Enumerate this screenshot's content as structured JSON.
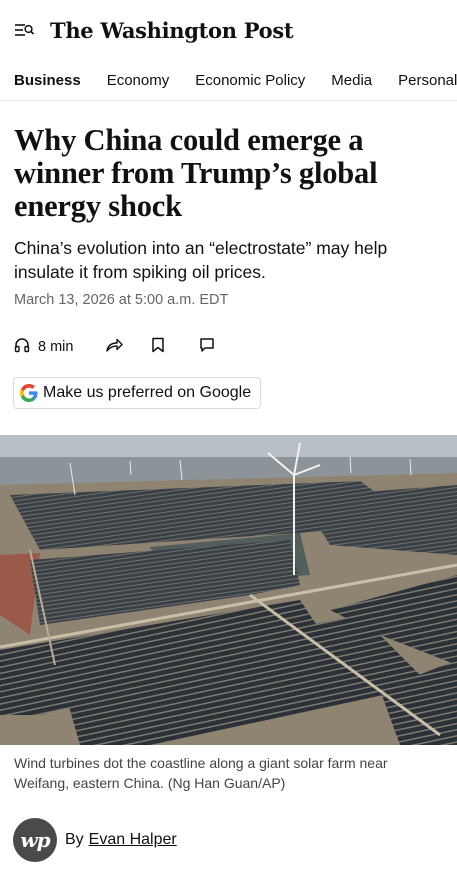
{
  "header": {
    "logo_text": "The Washington Post",
    "menu_icon": "menu-icon"
  },
  "nav": {
    "sections": [
      "Business",
      "Economy",
      "Economic Policy",
      "Media",
      "Personal Fina"
    ],
    "active": "Business"
  },
  "article": {
    "headline": "Why China could emerge a winner from Trump’s global energy shock",
    "dek": "China’s evolution into an “electrostate” may help insulate it from spiking oil prices.",
    "dateline": "March 13, 2026 at 5:00 a.m. EDT",
    "read_time": "8 min",
    "action_icons": [
      "headphones-icon",
      "share-icon",
      "bookmark-icon",
      "comment-icon"
    ],
    "google_pref_label": "Make us preferred on Google",
    "image_caption": "Wind turbines dot the coastline along a giant solar farm near Weifang, eastern China. (Ng Han Guan/AP)",
    "byline_prefix": "By",
    "author": "Evan Halper",
    "avatar_text": "wp"
  },
  "colors": {
    "text": "#111111",
    "muted": "#666666",
    "caption": "#444444",
    "divider": "#e6e6e6",
    "google_blue": "#4285F4",
    "google_red": "#EA4335",
    "google_yellow": "#FBBC05",
    "google_green": "#34A853"
  }
}
